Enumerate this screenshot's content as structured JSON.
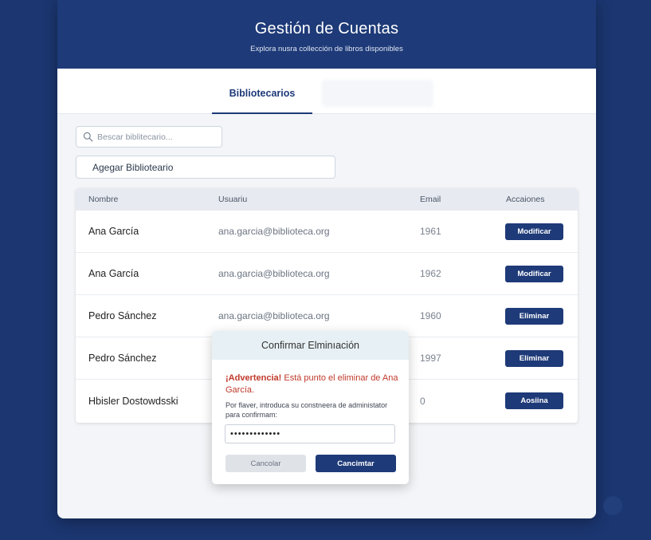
{
  "header": {
    "title": "Gestión de Cuentas",
    "subtitle": "Explora nusra collección de libros disponibles"
  },
  "tabs": {
    "active_label": "Bibliotecarios"
  },
  "search": {
    "placeholder": "Bescar biblitecario..."
  },
  "add_button_label": "Agegar Biblioteario",
  "table": {
    "headers": {
      "name": "Nombre",
      "user": "Usuariu",
      "email": "Email",
      "actions": "Accaiones"
    },
    "rows": [
      {
        "name": "Ana García",
        "user": "ana.garcia@biblioteca.org",
        "email": "1961",
        "action": "Modificar"
      },
      {
        "name": "Ana García",
        "user": "ana.garcia@biblioteca.org",
        "email": "1962",
        "action": "Modificar"
      },
      {
        "name": "Pedro Sánchez",
        "user": "ana.garcia@biblioteca.org",
        "email": "1960",
        "action": "Eliminar"
      },
      {
        "name": "Pedro Sánchez",
        "user": "",
        "email": "1997",
        "action": "Eliminar"
      },
      {
        "name": "Hbisler Dostowdsski",
        "user": "",
        "email": "0",
        "action": "Aosiina"
      }
    ]
  },
  "modal": {
    "title": "Confirmar Elminıación",
    "warning_bold": "¡Advertencia!",
    "warning_text": " Está punto el eliminar de Ana García.",
    "prompt": "Por flaver, introduca su constneera de administator para confirmam:",
    "password_value": "•••••••••••••",
    "cancel_label": "Cancolar",
    "confirm_label": "Cancimtar"
  },
  "colors": {
    "background": "#1b3670",
    "header": "#1e3a78",
    "primary_button": "#1e3a78",
    "warning_text": "#c0392b"
  }
}
